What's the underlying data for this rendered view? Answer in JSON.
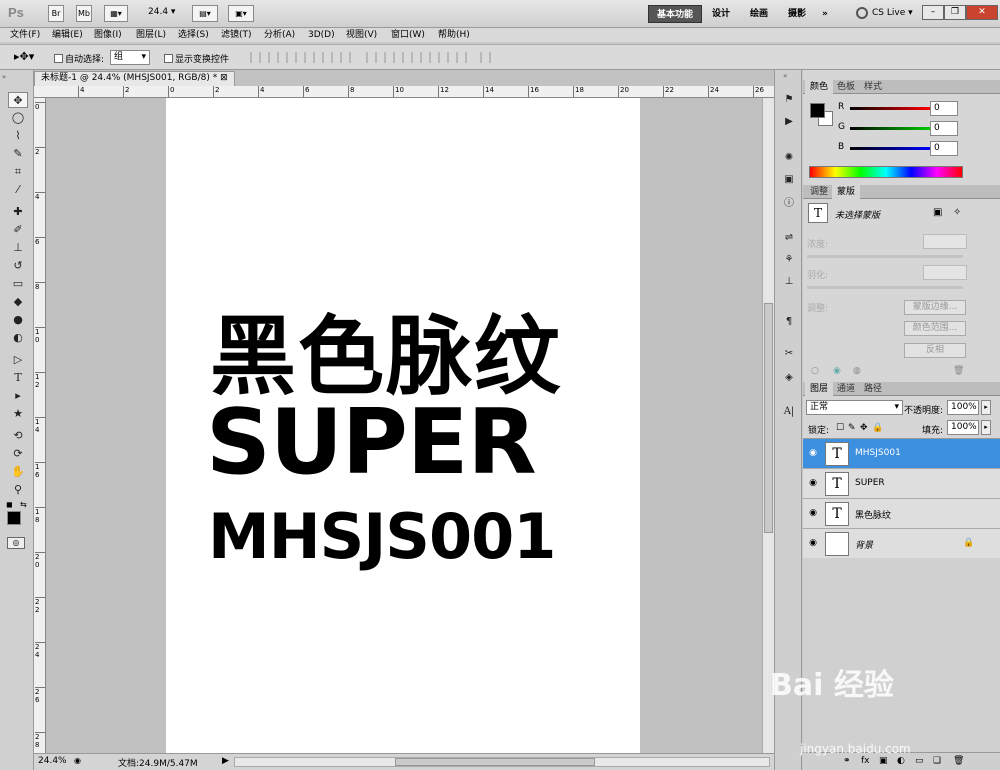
{
  "app": {
    "logo": "Ps",
    "zoom_value": "24.4",
    "workspaces": [
      "基本功能",
      "设计",
      "绘画",
      "摄影"
    ],
    "more_workspaces": "»",
    "cs_live": "CS Live"
  },
  "menus": [
    "文件(F)",
    "编辑(E)",
    "图像(I)",
    "图层(L)",
    "选择(S)",
    "滤镜(T)",
    "分析(A)",
    "3D(D)",
    "视图(V)",
    "窗口(W)",
    "帮助(H)"
  ],
  "options": {
    "auto_select_label": "自动选择:",
    "auto_select_value": "组",
    "show_transform_label": "显示变换控件"
  },
  "document": {
    "tab_title": "未标题-1 @ 24.4% (MHSJS001, RGB/8) *",
    "ruler_h_labels": [
      "4",
      "2",
      "0",
      "2",
      "4",
      "6",
      "8",
      "10",
      "12",
      "14",
      "16",
      "18",
      "20",
      "22",
      "24",
      "26"
    ],
    "ruler_v_labels": [
      "0",
      "2",
      "4",
      "6",
      "8",
      "1 0",
      "1 2",
      "1 4",
      "1 6",
      "1 8",
      "2 0",
      "2 2",
      "2 4",
      "2 6",
      "2 8"
    ],
    "text_line1": "黑色脉纹",
    "text_line2": "SUPER",
    "text_line3": "MHSJS001"
  },
  "status": {
    "zoom": "24.4%",
    "doc_info": "文档:24.9M/5.47M"
  },
  "color_panel": {
    "tabs": [
      "颜色",
      "色板",
      "样式"
    ],
    "channels": [
      {
        "label": "R",
        "value": "0",
        "color": "#d01010"
      },
      {
        "label": "G",
        "value": "0",
        "color": "#10a010"
      },
      {
        "label": "B",
        "value": "0",
        "color": "#1010c0"
      }
    ]
  },
  "masks_panel": {
    "tabs": [
      "调整",
      "蒙版"
    ],
    "no_mask_label": "未选择蒙版",
    "density_label": "浓度:",
    "feather_label": "羽化:",
    "refine_label": "调整:",
    "buttons": [
      "蒙版边缘...",
      "颜色范围...",
      "反相"
    ]
  },
  "layers_panel": {
    "tabs": [
      "图层",
      "通道",
      "路径"
    ],
    "blend_mode": "正常",
    "opacity_label": "不透明度:",
    "opacity_value": "100%",
    "lock_label": "锁定:",
    "fill_label": "填充:",
    "fill_value": "100%",
    "layers": [
      {
        "name": "MHSJS001",
        "type": "text",
        "selected": true
      },
      {
        "name": "SUPER",
        "type": "text",
        "selected": false
      },
      {
        "name": "黑色脉纹",
        "type": "text",
        "selected": false
      },
      {
        "name": "背景",
        "type": "background",
        "selected": false
      }
    ]
  },
  "watermark": {
    "brand": "Bai 经验",
    "url": "jingyan.baidu.com"
  }
}
